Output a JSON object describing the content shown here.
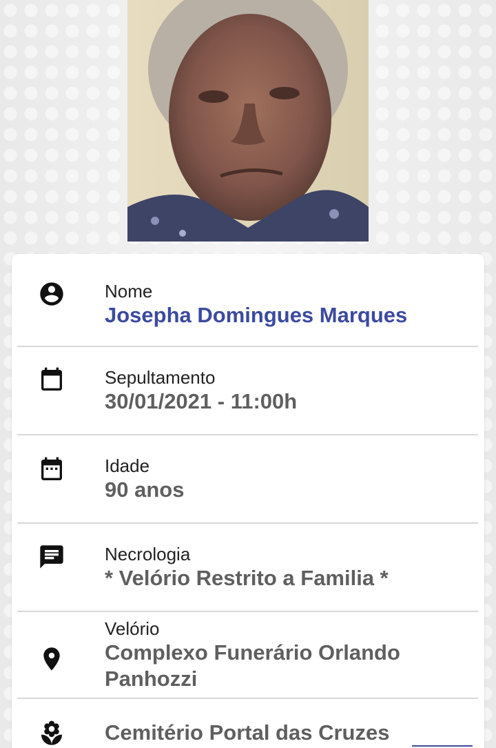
{
  "photo": {
    "alt": ""
  },
  "details": {
    "nome": {
      "label": "Nome",
      "value": "Josepha Domingues Marques",
      "icon": "account-circle-icon"
    },
    "sepultamento": {
      "label": "Sepultamento",
      "value": "30/01/2021 - 11:00h",
      "icon": "calendar-icon"
    },
    "idade": {
      "label": "Idade",
      "value": "90 anos",
      "icon": "calendar-dots-icon"
    },
    "necrologia": {
      "label": "Necrologia",
      "value": "* Velório Restrito a Familia *",
      "icon": "message-icon"
    },
    "velorio": {
      "label": "Velório",
      "value": "Complexo Funerário Orlando Panhozzi",
      "icon": "location-pin-icon"
    },
    "cemiterio": {
      "value": "Cemitério Portal das Cruzes",
      "icon": "flower-icon"
    }
  },
  "colors": {
    "accent": "#3c4a9e",
    "value_gray": "#5f5f5f",
    "divider": "#d8d8d8"
  }
}
